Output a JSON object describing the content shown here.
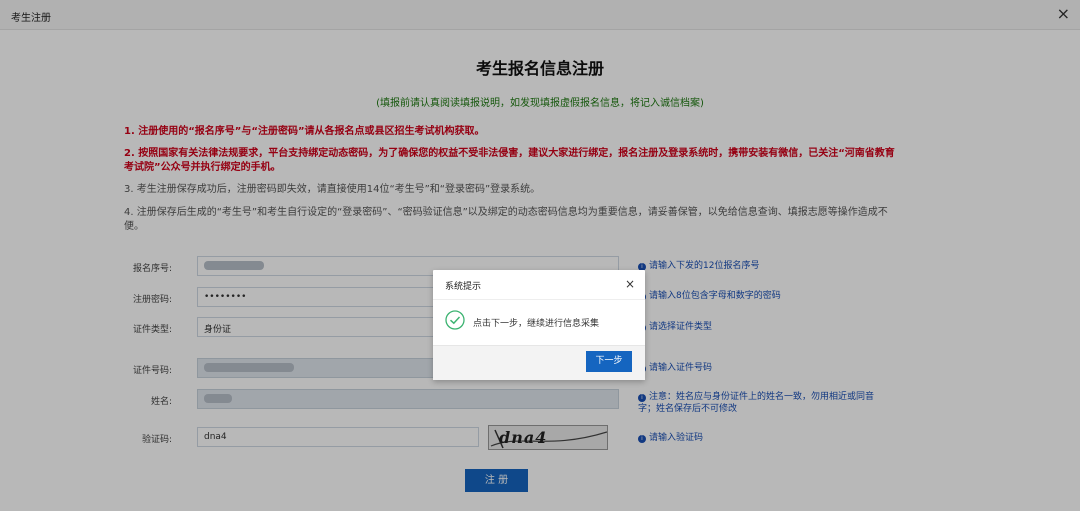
{
  "window": {
    "title": "考生注册",
    "close_glyph": "×"
  },
  "page": {
    "heading": "考生报名信息注册",
    "subtitle": "(填报前请认真阅读填报说明，如发现填报虚假报名信息，将记入诚信档案)",
    "notices": [
      "1. 注册使用的“报名序号”与“注册密码”请从各报名点或县区招生考试机构获取。",
      "2. 按照国家有关法律法规要求，平台支持绑定动态密码，为了确保您的权益不受非法侵害，建议大家进行绑定，报名注册及登录系统时，携带安装有微信，已关注“河南省教育考试院”公众号并执行绑定的手机。",
      "3. 考生注册保存成功后，注册密码即失效，请直接使用14位“考生号”和“登录密码”登录系统。",
      "4. 注册保存后生成的“考生号”和考生自行设定的“登录密码”、“密码验证信息”以及绑定的动态密码信息均为重要信息，请妥善保管，以免给信息查询、填报志愿等操作造成不便。"
    ]
  },
  "form": {
    "fields": [
      {
        "label": "报名序号:",
        "value": "",
        "hint": "请输入下发的12位报名序号"
      },
      {
        "label": "注册密码:",
        "value": "••••••••",
        "hint": "请输入8位包含字母和数字的密码"
      },
      {
        "label": "证件类型:",
        "value": "身份证",
        "hint": "请选择证件类型"
      },
      {
        "label": "证件号码:",
        "value": "",
        "hint": "请输入证件号码"
      },
      {
        "label": "姓名:",
        "value": "",
        "hint": "注意：姓名应与身份证件上的姓名一致，勿用相近或同音字；姓名保存后不可修改"
      },
      {
        "label": "验证码:",
        "value": "dna4",
        "hint": "请输入验证码"
      }
    ],
    "captcha_text": "dna4",
    "submit_label": "注 册",
    "hint_icon": "info-icon",
    "hint_icon_glyph": "i"
  },
  "dialog": {
    "title": "系统提示",
    "close_glyph": "×",
    "message": "点击下一步，继续进行信息采集",
    "icon": "check-circle-icon",
    "next_label": "下一步"
  },
  "colors": {
    "red_notice": "#d0021b",
    "green_subtitle": "#1f7a12",
    "hint_blue": "#1a4fb5",
    "button_blue": "#1565c0",
    "check_green": "#3cb371"
  }
}
